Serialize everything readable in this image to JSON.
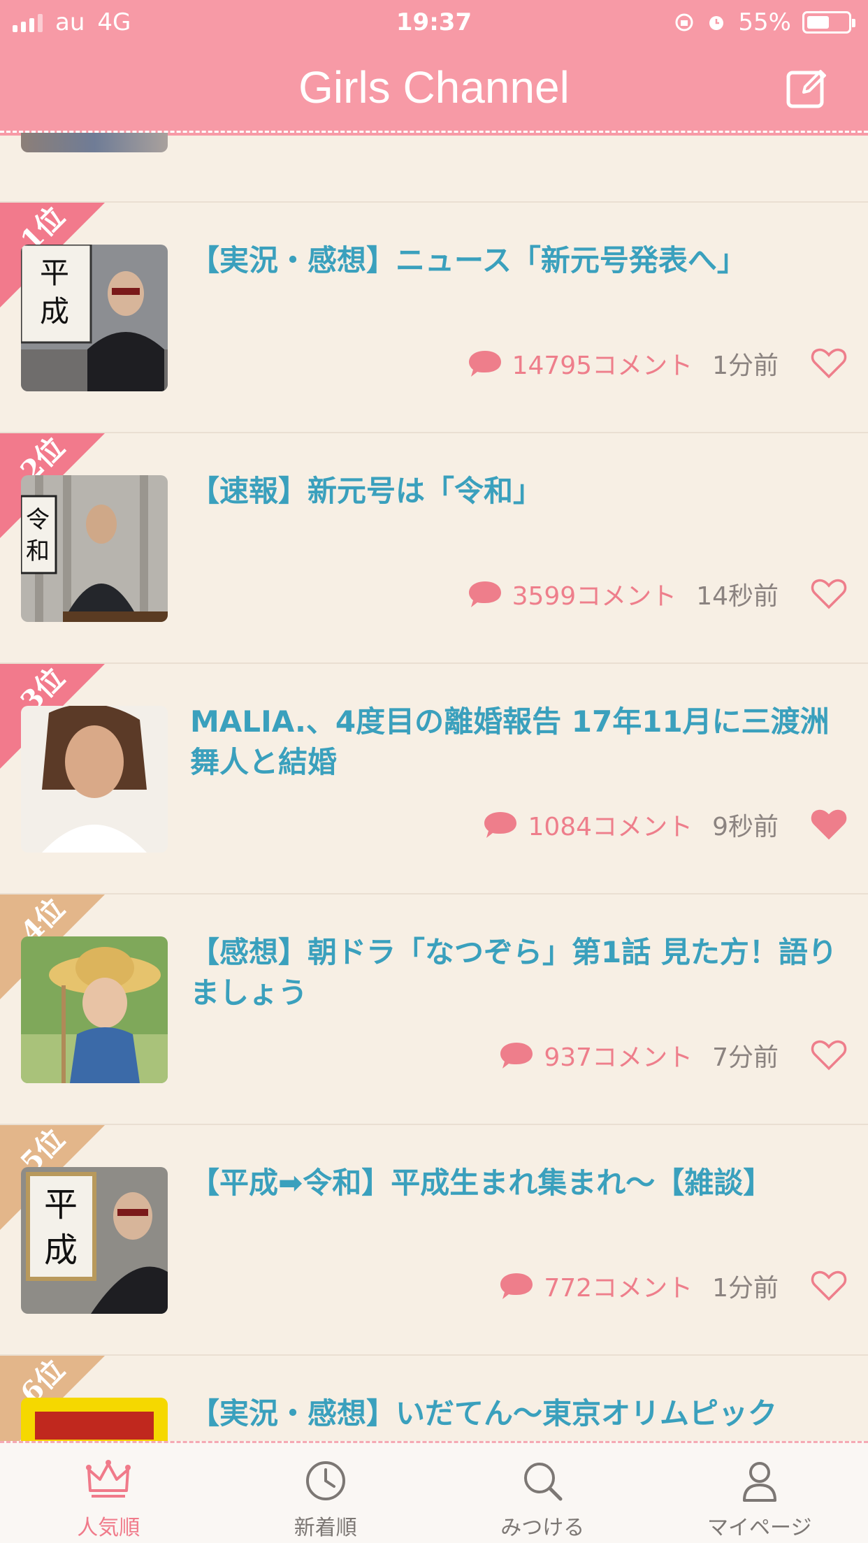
{
  "status_bar": {
    "carrier": "au",
    "network": "4G",
    "time": "19:37",
    "battery": "55%",
    "battery_level": 0.55
  },
  "header": {
    "title": "Girls Channel"
  },
  "colors": {
    "pink": "#f79aa6",
    "rank_pink": "#f27a8c",
    "rank_gold": "#e3b68a",
    "title_blue": "#3aa0bd",
    "comment_pink": "#ee7e8b"
  },
  "topics": [
    {
      "rank": "1位",
      "title": "【実況・感想】ニュース「新元号発表へ」",
      "comments": "14795コメント",
      "time": "1分前",
      "liked": false,
      "rank_style": "pink"
    },
    {
      "rank": "2位",
      "title": "【速報】新元号は「令和」",
      "comments": "3599コメント",
      "time": "14秒前",
      "liked": false,
      "rank_style": "pink"
    },
    {
      "rank": "3位",
      "title": "MALIA.、4度目の離婚報告 17年11月に三渡洲舞人と結婚",
      "comments": "1084コメント",
      "time": "9秒前",
      "liked": true,
      "rank_style": "pink"
    },
    {
      "rank": "4位",
      "title": "【感想】朝ドラ「なつぞら」第1話 見た方！語りましょう",
      "comments": "937コメント",
      "time": "7分前",
      "liked": false,
      "rank_style": "gold"
    },
    {
      "rank": "5位",
      "title": "【平成➡令和】平成生まれ集まれ〜【雑談】",
      "comments": "772コメント",
      "time": "1分前",
      "liked": false,
      "rank_style": "gold"
    },
    {
      "rank": "6位",
      "title": "【実況・感想】いだてん〜東京オリムピック",
      "comments": "",
      "time": "",
      "liked": false,
      "rank_style": "gold"
    }
  ],
  "tabs": [
    {
      "label": "人気順",
      "icon": "crown-icon",
      "active": true
    },
    {
      "label": "新着順",
      "icon": "clock-icon",
      "active": false
    },
    {
      "label": "みつける",
      "icon": "search-icon",
      "active": false
    },
    {
      "label": "マイページ",
      "icon": "user-icon",
      "active": false
    }
  ]
}
